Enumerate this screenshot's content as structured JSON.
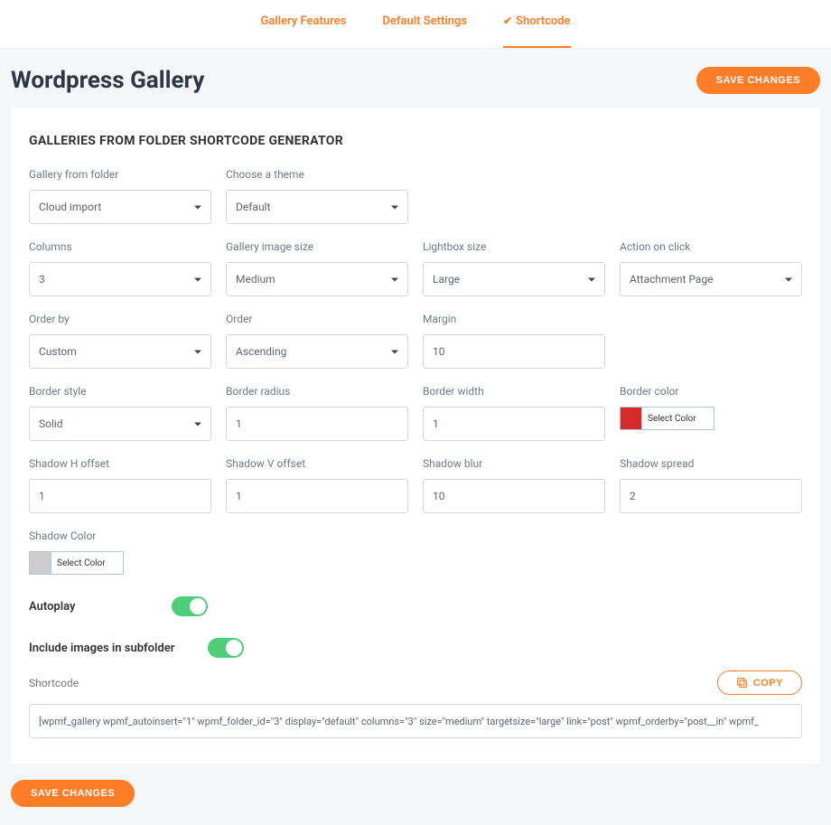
{
  "tabs": {
    "features": "Gallery Features",
    "defaults": "Default Settings",
    "shortcode": "Shortcode"
  },
  "page_title": "Wordpress Gallery",
  "save_button": "SAVE CHANGES",
  "panel_title": "GALLERIES FROM FOLDER SHORTCODE GENERATOR",
  "fields": {
    "folder": {
      "label": "Gallery from folder",
      "value": "Cloud import"
    },
    "theme": {
      "label": "Choose a theme",
      "value": "Default"
    },
    "columns": {
      "label": "Columns",
      "value": "3"
    },
    "image_size": {
      "label": "Gallery image size",
      "value": "Medium"
    },
    "lightbox_size": {
      "label": "Lightbox size",
      "value": "Large"
    },
    "action": {
      "label": "Action on click",
      "value": "Attachment Page"
    },
    "order_by": {
      "label": "Order by",
      "value": "Custom"
    },
    "order": {
      "label": "Order",
      "value": "Ascending"
    },
    "margin": {
      "label": "Margin",
      "value": "10"
    },
    "border_style": {
      "label": "Border style",
      "value": "Solid"
    },
    "border_radius": {
      "label": "Border radius",
      "value": "1"
    },
    "border_width": {
      "label": "Border width",
      "value": "1"
    },
    "border_color": {
      "label": "Border color",
      "value": "Select Color",
      "swatch": "#d62a2a"
    },
    "shadow_h": {
      "label": "Shadow H offset",
      "value": "1"
    },
    "shadow_v": {
      "label": "Shadow V offset",
      "value": "1"
    },
    "shadow_blur": {
      "label": "Shadow blur",
      "value": "10"
    },
    "shadow_spread": {
      "label": "Shadow spread",
      "value": "2"
    },
    "shadow_color": {
      "label": "Shadow Color",
      "value": "Select Color",
      "swatch": "#cccccc"
    }
  },
  "toggles": {
    "autoplay": "Autoplay",
    "subfolder": "Include images in subfolder"
  },
  "shortcode": {
    "label": "Shortcode",
    "copy": "COPY",
    "value": "[wpmf_gallery wpmf_autoinsert=\"1\" wpmf_folder_id=\"3\" display=\"default\" columns=\"3\" size=\"medium\" targetsize=\"large\" link=\"post\" wpmf_orderby=\"post__in\" wpmf_"
  }
}
